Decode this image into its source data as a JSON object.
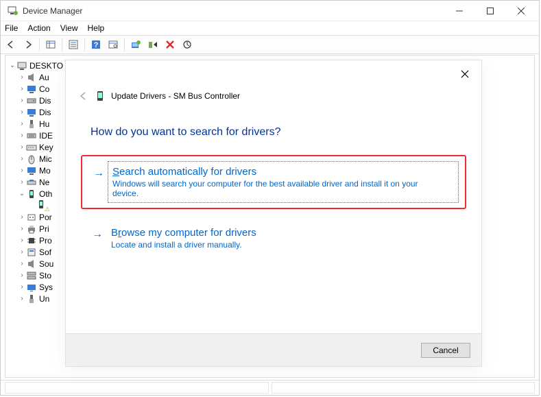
{
  "window": {
    "title": "Device Manager"
  },
  "menu": {
    "file": "File",
    "action": "Action",
    "view": "View",
    "help": "Help"
  },
  "tree": {
    "root": "DESKTO",
    "items": [
      "Au",
      "Co",
      "Dis",
      "Dis",
      "Hu",
      "IDE",
      "Key",
      "Mic",
      "Mo",
      "Ne",
      "Oth",
      "Por",
      "Pri",
      "Pro",
      "Sof",
      "Sou",
      "Sto",
      "Sys",
      "Un"
    ],
    "warn_child": ""
  },
  "dialog": {
    "header": "Update Drivers - SM Bus Controller",
    "heading": "How do you want to search for drivers?",
    "option1": {
      "title_pre": "S",
      "title_rest": "earch automatically for drivers",
      "desc": "Windows will search your computer for the best available driver and install it on your device."
    },
    "option2": {
      "title_pre": "B",
      "title_mid": "r",
      "title_rest": "owse my computer for drivers",
      "desc": "Locate and install a driver manually."
    },
    "cancel": "Cancel"
  }
}
